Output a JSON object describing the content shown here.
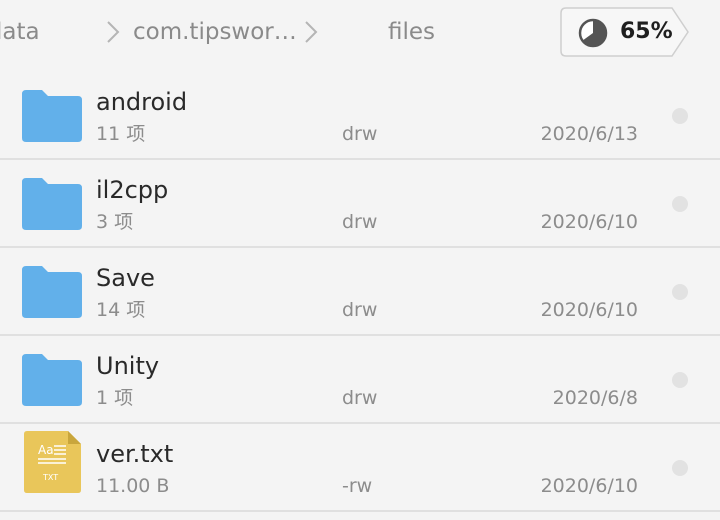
{
  "breadcrumb": {
    "items": [
      "lata",
      "com.tipswor…",
      "files"
    ],
    "storage_percent": "65%"
  },
  "files": [
    {
      "name": "android",
      "info": "11 项",
      "perm": "drw",
      "date": "2020/6/13",
      "type": "folder"
    },
    {
      "name": "il2cpp",
      "info": "3 项",
      "perm": "drw",
      "date": "2020/6/10",
      "type": "folder"
    },
    {
      "name": "Save",
      "info": "14 项",
      "perm": "drw",
      "date": "2020/6/10",
      "type": "folder"
    },
    {
      "name": "Unity",
      "info": "1 项",
      "perm": "drw",
      "date": "2020/6/8",
      "type": "folder"
    },
    {
      "name": "ver.txt",
      "info": "11.00 B",
      "perm": "-rw",
      "date": "2020/6/10",
      "type": "txt"
    }
  ],
  "icons": {
    "folder": "folder-icon",
    "txt": "txt-file-icon",
    "storage": "pie-chart-icon",
    "separator": "chevron-right-icon"
  },
  "colors": {
    "folder": "#62b0ea",
    "txt_file": "#e9c65a",
    "background": "#f4f4f4"
  },
  "storage_used_fraction": 0.65
}
